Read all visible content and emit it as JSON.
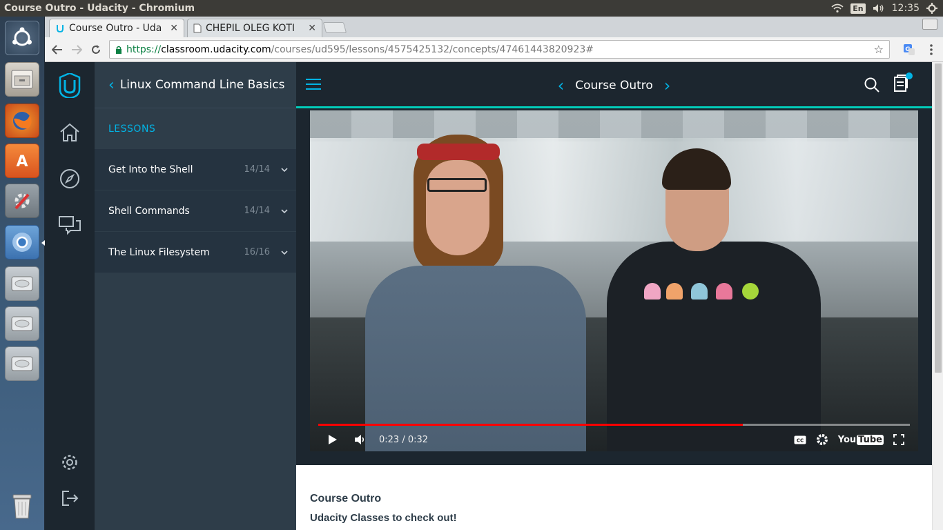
{
  "panel": {
    "window_title": "Course Outro - Udacity - Chromium",
    "lang": "En",
    "clock": "12:35"
  },
  "launcher": {
    "items": [
      "ubuntu-dash-icon",
      "files-icon",
      "firefox-icon",
      "software-center-icon",
      "system-settings-icon",
      "chromium-icon",
      "drive-icon",
      "drive-icon",
      "drive-icon",
      "trash-icon"
    ]
  },
  "browser": {
    "tabs": [
      {
        "label": "Course Outro - Uda",
        "active": true
      },
      {
        "label": "CHEPIL OLEG KOTI",
        "active": false
      }
    ],
    "url": {
      "scheme": "https://",
      "host": "classroom.udacity.com",
      "path": "/courses/ud595/lessons/4575425132/concepts/47461443820923#"
    }
  },
  "sidebar": {
    "course_title": "Linux Command Line Basics",
    "lessons_label": "LESSONS",
    "lessons": [
      {
        "title": "Get Into the Shell",
        "count": "14/14"
      },
      {
        "title": "Shell Commands",
        "count": "14/14"
      },
      {
        "title": "The Linux Filesystem",
        "count": "16/16"
      }
    ]
  },
  "header": {
    "concept_title": "Course Outro"
  },
  "video": {
    "time": "0:23 / 0:32",
    "progress_fraction": 0.718,
    "brand": "You",
    "brand_tube": "Tube"
  },
  "content": {
    "heading": "Course Outro",
    "subheading": "Udacity Classes to check out!"
  },
  "colors": {
    "accent": "#02b3e4",
    "teal": "#02ccba",
    "rail": "#1c262f",
    "sidebar": "#2e3d49"
  }
}
